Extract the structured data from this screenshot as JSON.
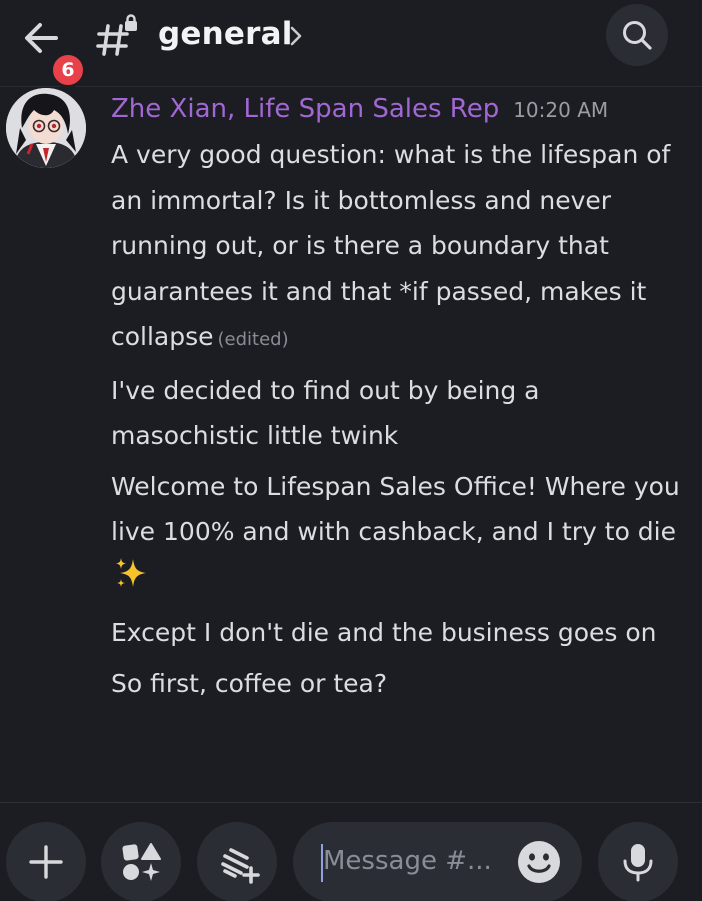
{
  "header": {
    "back_icon": "arrow-left-icon",
    "unread_badge": "6",
    "channel_icon": "hash-lock-icon",
    "channel_name": "general",
    "chevron_icon": "chevron-right-icon",
    "search_icon": "search-icon"
  },
  "message": {
    "author": "Zhe Xian, Life Span Sales Rep",
    "author_color": "#a167d3",
    "timestamp": "10:20 AM",
    "paragraphs": [
      "A very good question: what is the lifespan of an immortal? Is it bottomless and never running out, or is there a boundary that guarantees it and that *if passed, makes it collapse",
      "I've decided to find out by being a masochistic little twink",
      "Welcome to Lifespan Sales Office! Where you live 100% and with cashback, and I try to die",
      "Except I don't die and the business goes on",
      "So first, coffee or tea?"
    ],
    "edited_label": "(edited)",
    "sparkle_emoji": "✨"
  },
  "composer": {
    "add_icon": "plus-icon",
    "apps_icon": "apps-icon",
    "threads_icon": "threads-add-icon",
    "placeholder": "Message #...",
    "emoji_icon": "smiley-icon",
    "mic_icon": "microphone-icon"
  },
  "colors": {
    "background": "#1c1d22",
    "badge": "#e8414a",
    "button_bg": "#2b2d35"
  }
}
